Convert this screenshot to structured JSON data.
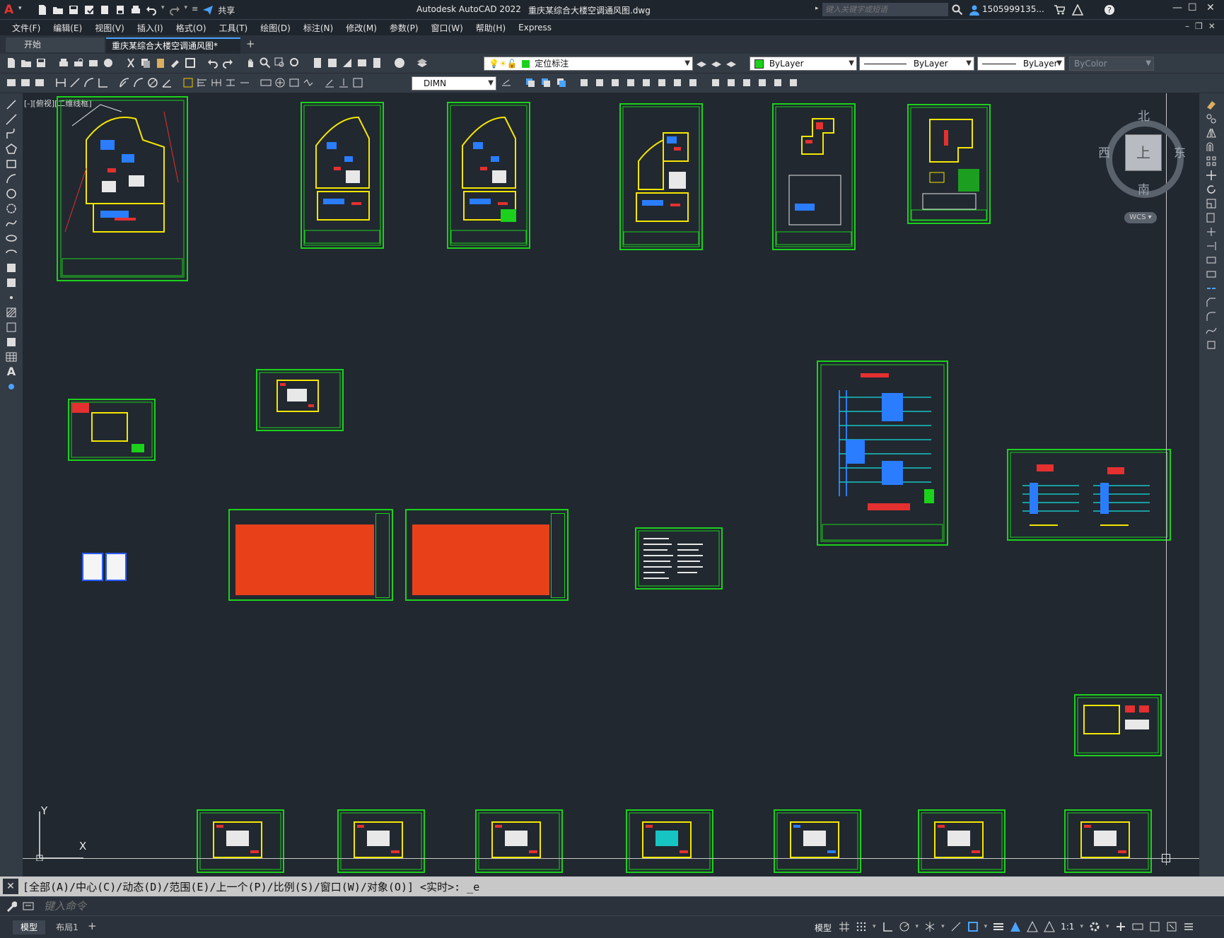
{
  "titlebar": {
    "app_title": "Autodesk AutoCAD 2022",
    "file_title": "重庆某综合大楼空调通风图.dwg",
    "share_label": "共享",
    "search_placeholder": "键入关键字或短语",
    "user": "1505999135...",
    "minimize": "—",
    "maximize": "☐",
    "close": "✕"
  },
  "menu": [
    "文件(F)",
    "编辑(E)",
    "视图(V)",
    "插入(I)",
    "格式(O)",
    "工具(T)",
    "绘图(D)",
    "标注(N)",
    "修改(M)",
    "参数(P)",
    "窗口(W)",
    "帮助(H)",
    "Express"
  ],
  "tabs": {
    "start": "开始",
    "drawing": "重庆某综合大楼空调通风图*",
    "add": "+"
  },
  "toolbar": {
    "layer_name": "定位标注",
    "color": "ByLayer",
    "linetype": "ByLayer",
    "lineweight": "ByLayer",
    "plotstyle": "ByColor",
    "dimstyle": "DIMN"
  },
  "viewport": {
    "label": "[-][俯视][二维线框]",
    "viewcube": {
      "north": "北",
      "south": "南",
      "east": "东",
      "west": "西",
      "top": "上",
      "wcs": "WCS"
    },
    "ucs": {
      "x": "X",
      "y": "Y"
    }
  },
  "command": {
    "history": "[全部(A)/中心(C)/动态(D)/范围(E)/上一个(P)/比例(S)/窗口(W)/对象(O)] <实时>: _e",
    "placeholder": "键入命令"
  },
  "status": {
    "layout_tabs": [
      "模型",
      "布局1"
    ],
    "add": "+",
    "model": "模型",
    "scale": "1:1"
  },
  "colors": {
    "frame_green": "#1bd11b",
    "table_red": "#e8411a",
    "canvas_bg": "#212830"
  }
}
